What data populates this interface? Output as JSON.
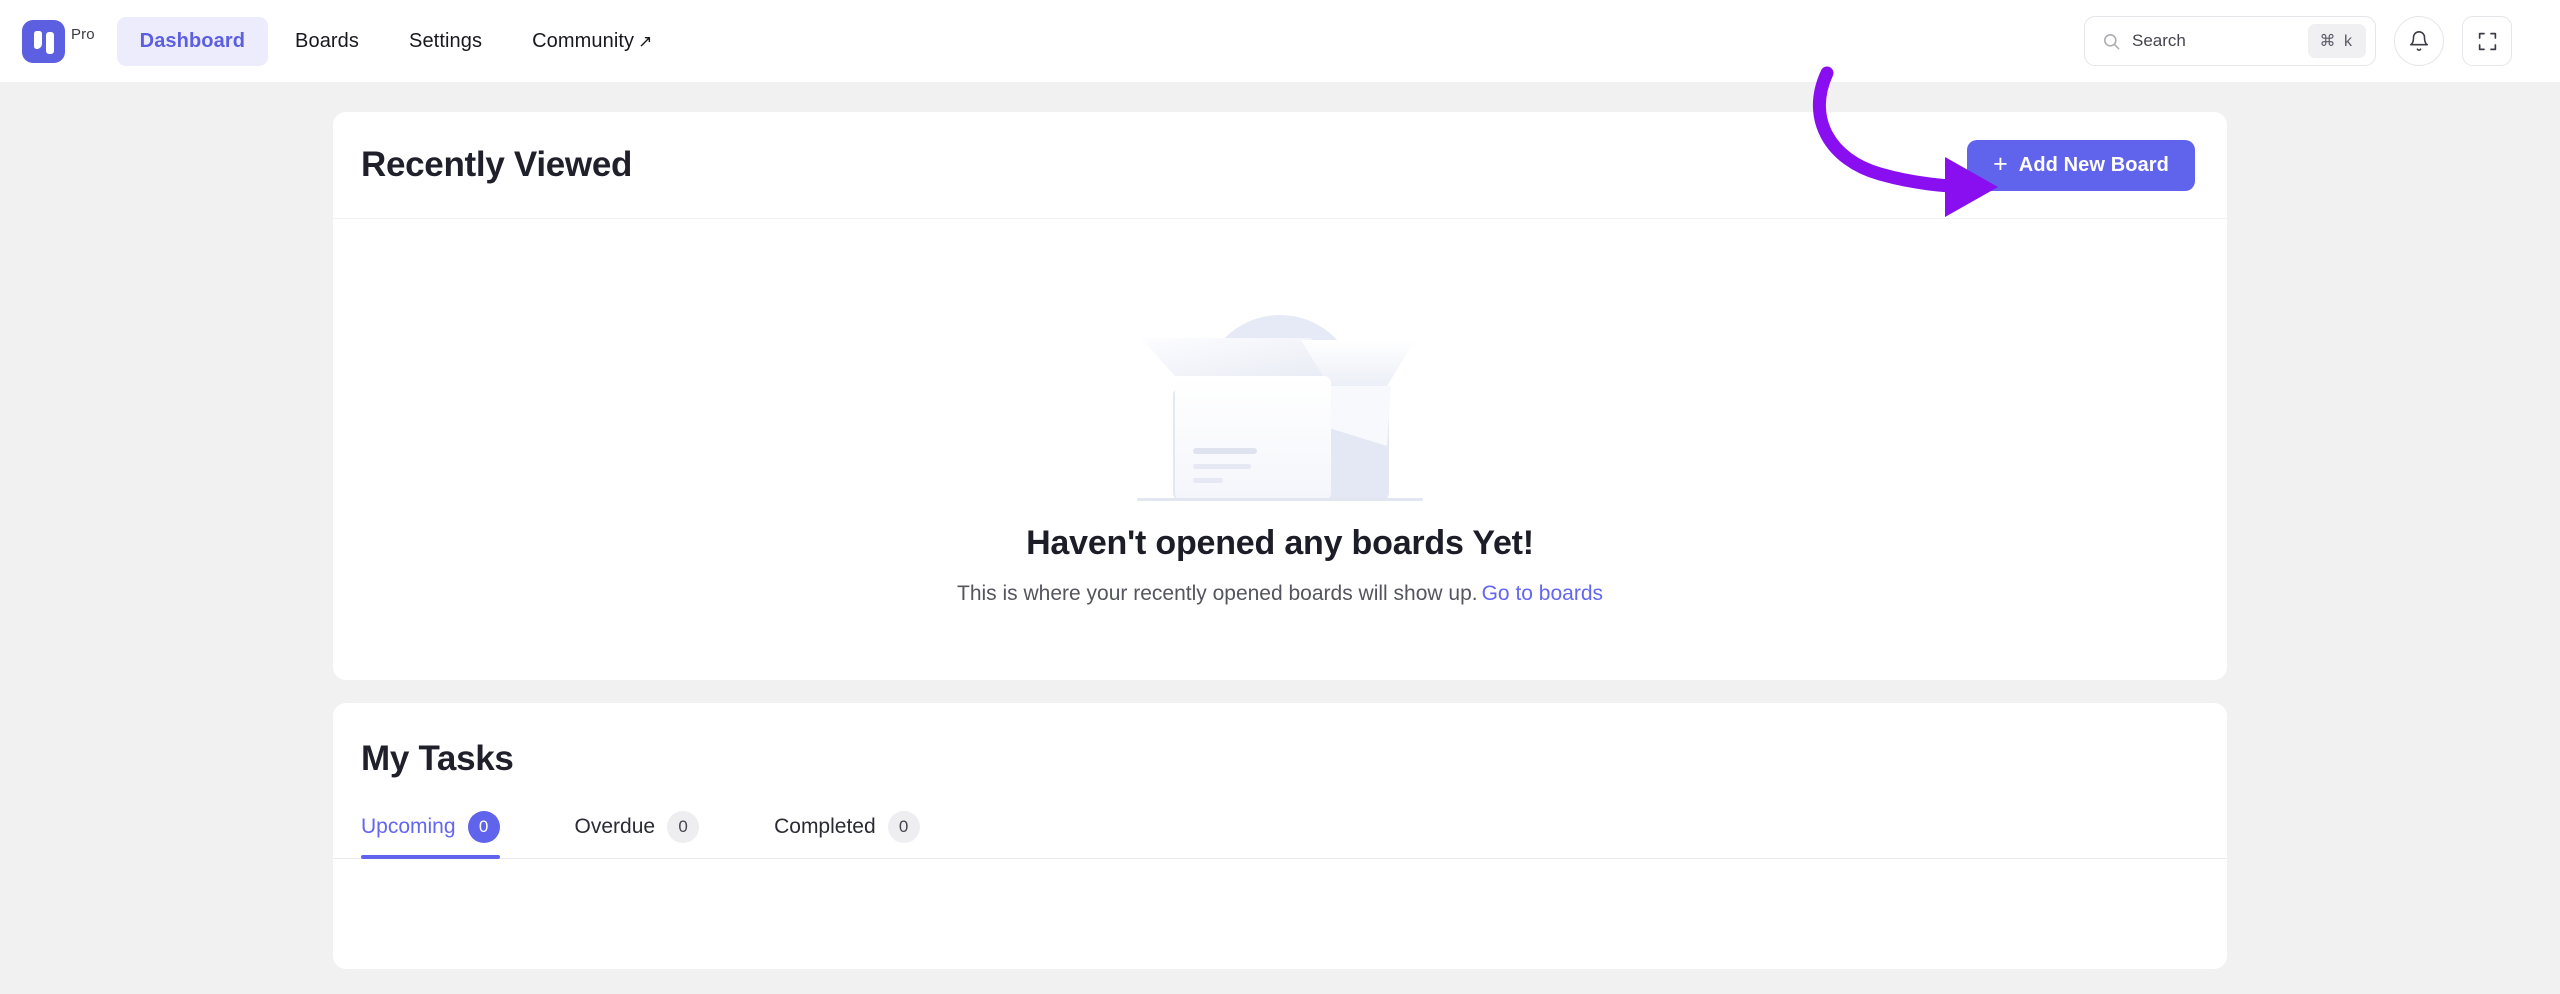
{
  "navbar": {
    "brand": {
      "logo_icon": "app-logo-icon",
      "plan_label": "Pro",
      "logo_color": "#5b5fe0"
    },
    "links": [
      {
        "label": "Dashboard",
        "active": true
      },
      {
        "label": "Boards",
        "active": false
      },
      {
        "label": "Settings",
        "active": false
      },
      {
        "label": "Community",
        "active": false,
        "external": true,
        "external_glyph": "↗"
      }
    ],
    "search": {
      "icon": "search-icon",
      "placeholder": "Search",
      "shortcut": "⌘ k"
    },
    "notifications_icon": "bell-icon",
    "fullscreen_icon": "fullscreen-icon"
  },
  "recently_viewed": {
    "title": "Recently Viewed",
    "add_button": {
      "label": "Add New Board",
      "plus": "+",
      "color": "#6063ec"
    },
    "empty_state": {
      "illustration": "open-box-illustration",
      "title": "Haven't opened any boards Yet!",
      "subtitle": "This is where your recently opened boards will show up.",
      "link_label": "Go to boards",
      "link_color": "#6366f1"
    }
  },
  "my_tasks": {
    "title": "My Tasks",
    "tabs": [
      {
        "label": "Upcoming",
        "count": "0",
        "active": true
      },
      {
        "label": "Overdue",
        "count": "0",
        "active": false
      },
      {
        "label": "Completed",
        "count": "0",
        "active": false
      }
    ]
  },
  "annotation": {
    "type": "curved-arrow",
    "color": "#8a0ff0",
    "points_to": "Add New Board"
  }
}
